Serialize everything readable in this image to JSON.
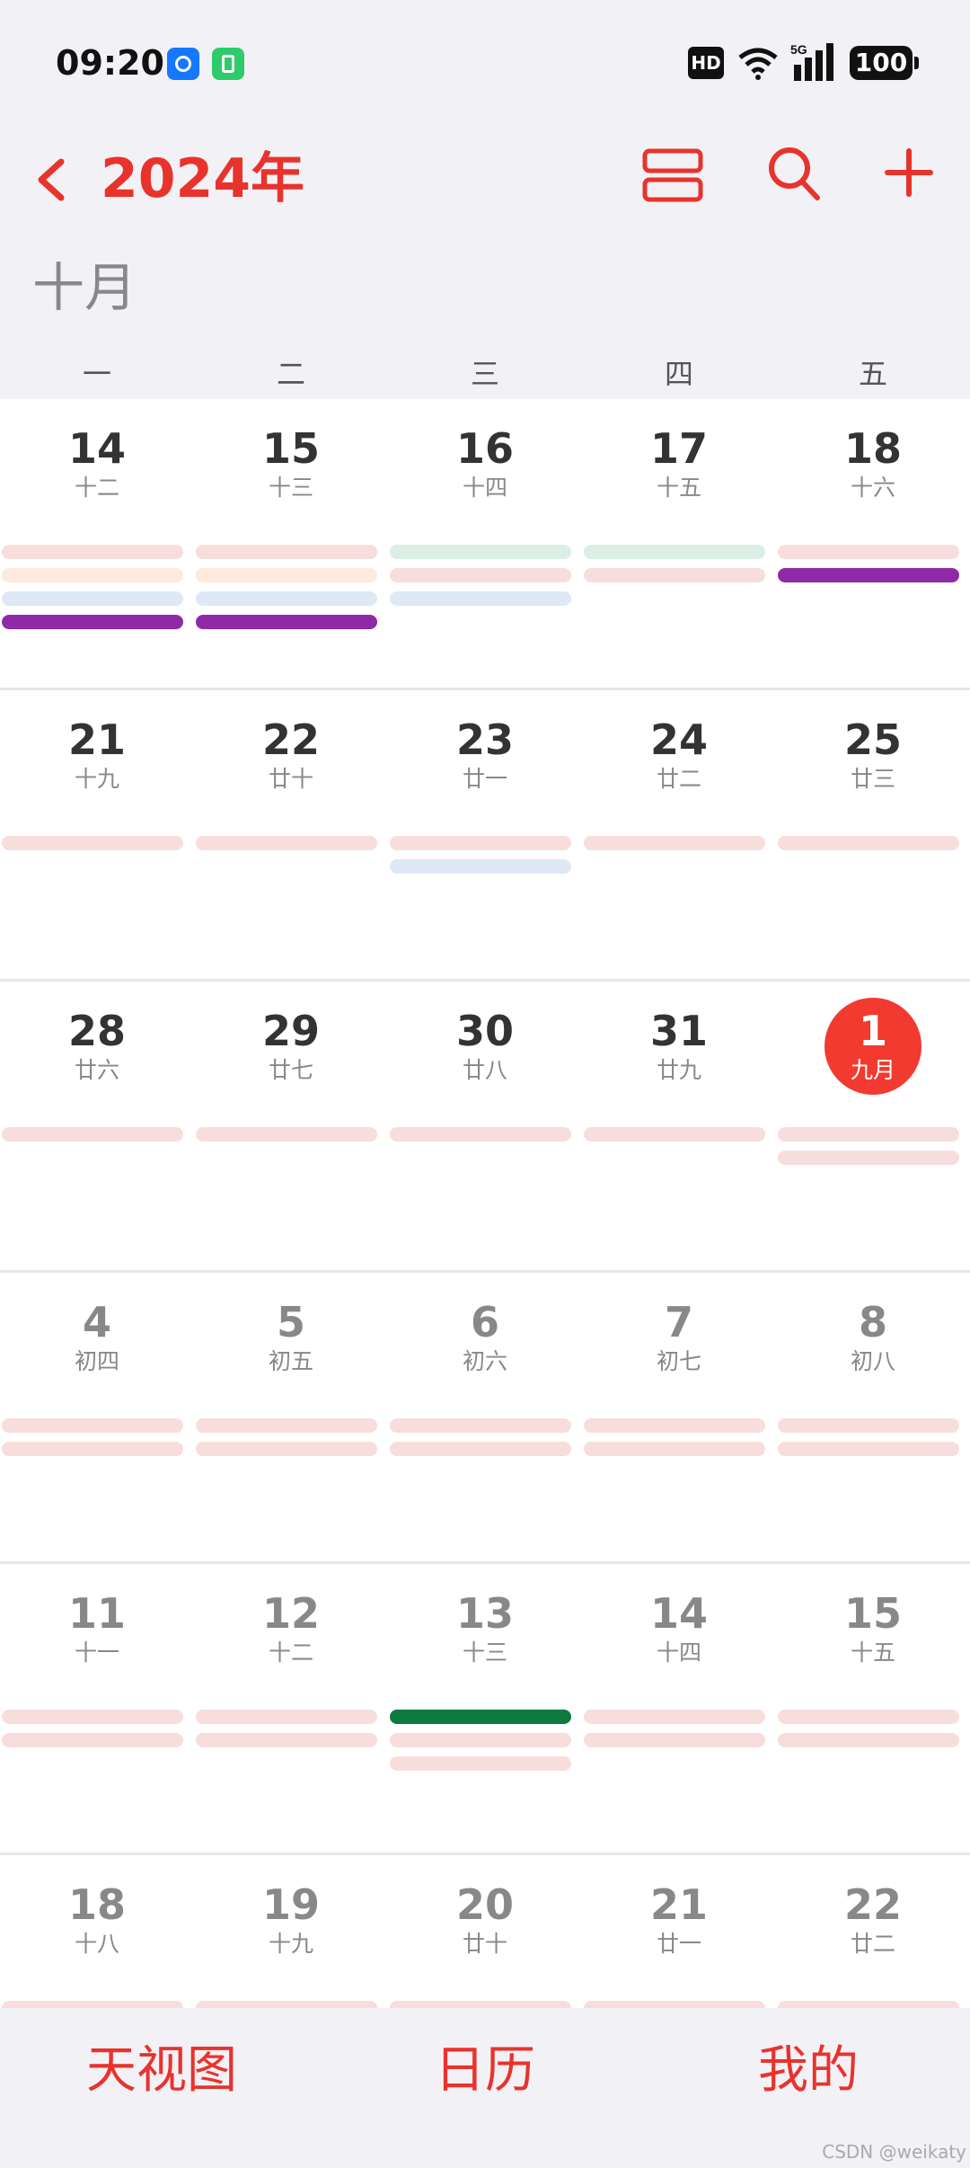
{
  "status_bar": {
    "time": "09:20",
    "hd": "HD",
    "network": "5G",
    "battery": "100",
    "icons": [
      "chat-app-icon",
      "battery-saver-icon",
      "wifi-icon",
      "signal-icon",
      "battery-icon"
    ]
  },
  "header": {
    "back_icon": "chevron-left-icon",
    "year_title": "2024年",
    "actions": [
      "view-toggle-icon",
      "search-icon",
      "add-icon"
    ]
  },
  "month_label": "十月",
  "weekdays": [
    "一",
    "二",
    "三",
    "四",
    "五"
  ],
  "weeks": [
    {
      "days": [
        {
          "num": "14",
          "lunar": "十二"
        },
        {
          "num": "15",
          "lunar": "十三"
        },
        {
          "num": "16",
          "lunar": "十四"
        },
        {
          "num": "17",
          "lunar": "十五"
        },
        {
          "num": "18",
          "lunar": "十六"
        }
      ]
    },
    {
      "days": [
        {
          "num": "21",
          "lunar": "十九"
        },
        {
          "num": "22",
          "lunar": "廿十"
        },
        {
          "num": "23",
          "lunar": "廿一"
        },
        {
          "num": "24",
          "lunar": "廿二"
        },
        {
          "num": "25",
          "lunar": "廿三"
        }
      ]
    },
    {
      "days": [
        {
          "num": "28",
          "lunar": "廿六"
        },
        {
          "num": "29",
          "lunar": "廿七"
        },
        {
          "num": "30",
          "lunar": "廿八"
        },
        {
          "num": "31",
          "lunar": "廿九"
        },
        {
          "num": "1",
          "lunar": "九月"
        }
      ]
    },
    {
      "days": [
        {
          "num": "4",
          "lunar": "初四"
        },
        {
          "num": "5",
          "lunar": "初五"
        },
        {
          "num": "6",
          "lunar": "初六"
        },
        {
          "num": "7",
          "lunar": "初七"
        },
        {
          "num": "8",
          "lunar": "初八"
        }
      ]
    },
    {
      "days": [
        {
          "num": "11",
          "lunar": "十一"
        },
        {
          "num": "12",
          "lunar": "十二"
        },
        {
          "num": "13",
          "lunar": "十三"
        },
        {
          "num": "14",
          "lunar": "十四"
        },
        {
          "num": "15",
          "lunar": "十五"
        }
      ]
    },
    {
      "days": [
        {
          "num": "18",
          "lunar": "十八"
        },
        {
          "num": "19",
          "lunar": "十九"
        },
        {
          "num": "20",
          "lunar": "廿十"
        },
        {
          "num": "21",
          "lunar": "廿一"
        },
        {
          "num": "22",
          "lunar": "廿二"
        }
      ]
    }
  ],
  "colors": {
    "accent": "#e8332c",
    "today": "#f23a31",
    "event_purple": "#8e2aa8",
    "event_green": "#0d7a3e",
    "event_pink": "#f8dddd"
  },
  "bottom_nav": {
    "day_view": "天视图",
    "calendar": "日历",
    "mine": "我的"
  },
  "watermark": "CSDN @weikaty"
}
